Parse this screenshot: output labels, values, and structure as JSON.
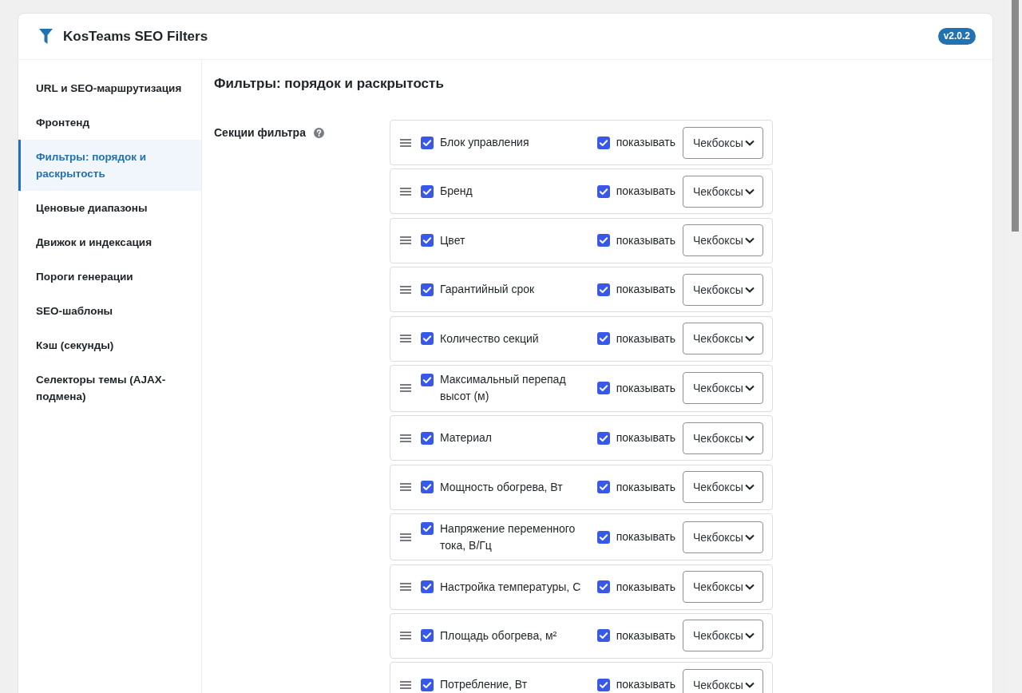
{
  "header": {
    "title": "KosTeams SEO Filters",
    "version": "v2.0.2"
  },
  "sidebar": {
    "items": [
      {
        "label": "URL и SEO-маршрутизация",
        "selected": false
      },
      {
        "label": "Фронтенд",
        "selected": false
      },
      {
        "label": "Фильтры: порядок и раскрытость",
        "selected": true
      },
      {
        "label": "Ценовые диапазоны",
        "selected": false
      },
      {
        "label": "Движок и индексация",
        "selected": false
      },
      {
        "label": "Пороги генерации",
        "selected": false
      },
      {
        "label": "SEO-шаблоны",
        "selected": false
      },
      {
        "label": "Кэш (секунды)",
        "selected": false
      },
      {
        "label": "Селекторы темы (AJAX-подмена)",
        "selected": false
      }
    ]
  },
  "content": {
    "title": "Фильтры: порядок и раскрытость",
    "field_label": "Секции фильтра",
    "sections": [
      {
        "name": "Блок управления",
        "checked": true,
        "show_label": "показывать",
        "show_checked": true,
        "display": "Чекбоксы"
      },
      {
        "name": "Бренд",
        "checked": true,
        "show_label": "показывать",
        "show_checked": true,
        "display": "Чекбоксы"
      },
      {
        "name": "Цвет",
        "checked": true,
        "show_label": "показывать",
        "show_checked": true,
        "display": "Чекбоксы"
      },
      {
        "name": "Гарантийный срок",
        "checked": true,
        "show_label": "показывать",
        "show_checked": true,
        "display": "Чекбоксы"
      },
      {
        "name": "Количество секций",
        "checked": true,
        "show_label": "показывать",
        "show_checked": true,
        "display": "Чекбоксы"
      },
      {
        "name": "Максимальный перепад высот (м)",
        "checked": true,
        "show_label": "показывать",
        "show_checked": true,
        "display": "Чекбоксы"
      },
      {
        "name": "Материал",
        "checked": true,
        "show_label": "показывать",
        "show_checked": true,
        "display": "Чекбоксы"
      },
      {
        "name": "Мощность обогрева, Вт",
        "checked": true,
        "show_label": "показывать",
        "show_checked": true,
        "display": "Чекбоксы"
      },
      {
        "name": "Напряжение переменного тока, В/Гц",
        "checked": true,
        "show_label": "показывать",
        "show_checked": true,
        "display": "Чекбоксы"
      },
      {
        "name": "Настройка температуры, С",
        "checked": true,
        "show_label": "показывать",
        "show_checked": true,
        "display": "Чекбоксы"
      },
      {
        "name": "Площадь обогрева, м²",
        "checked": true,
        "show_label": "показывать",
        "show_checked": true,
        "display": "Чекбоксы"
      },
      {
        "name": "Потребление, Вт",
        "checked": true,
        "show_label": "показывать",
        "show_checked": true,
        "display": "Чекбоксы"
      }
    ]
  }
}
